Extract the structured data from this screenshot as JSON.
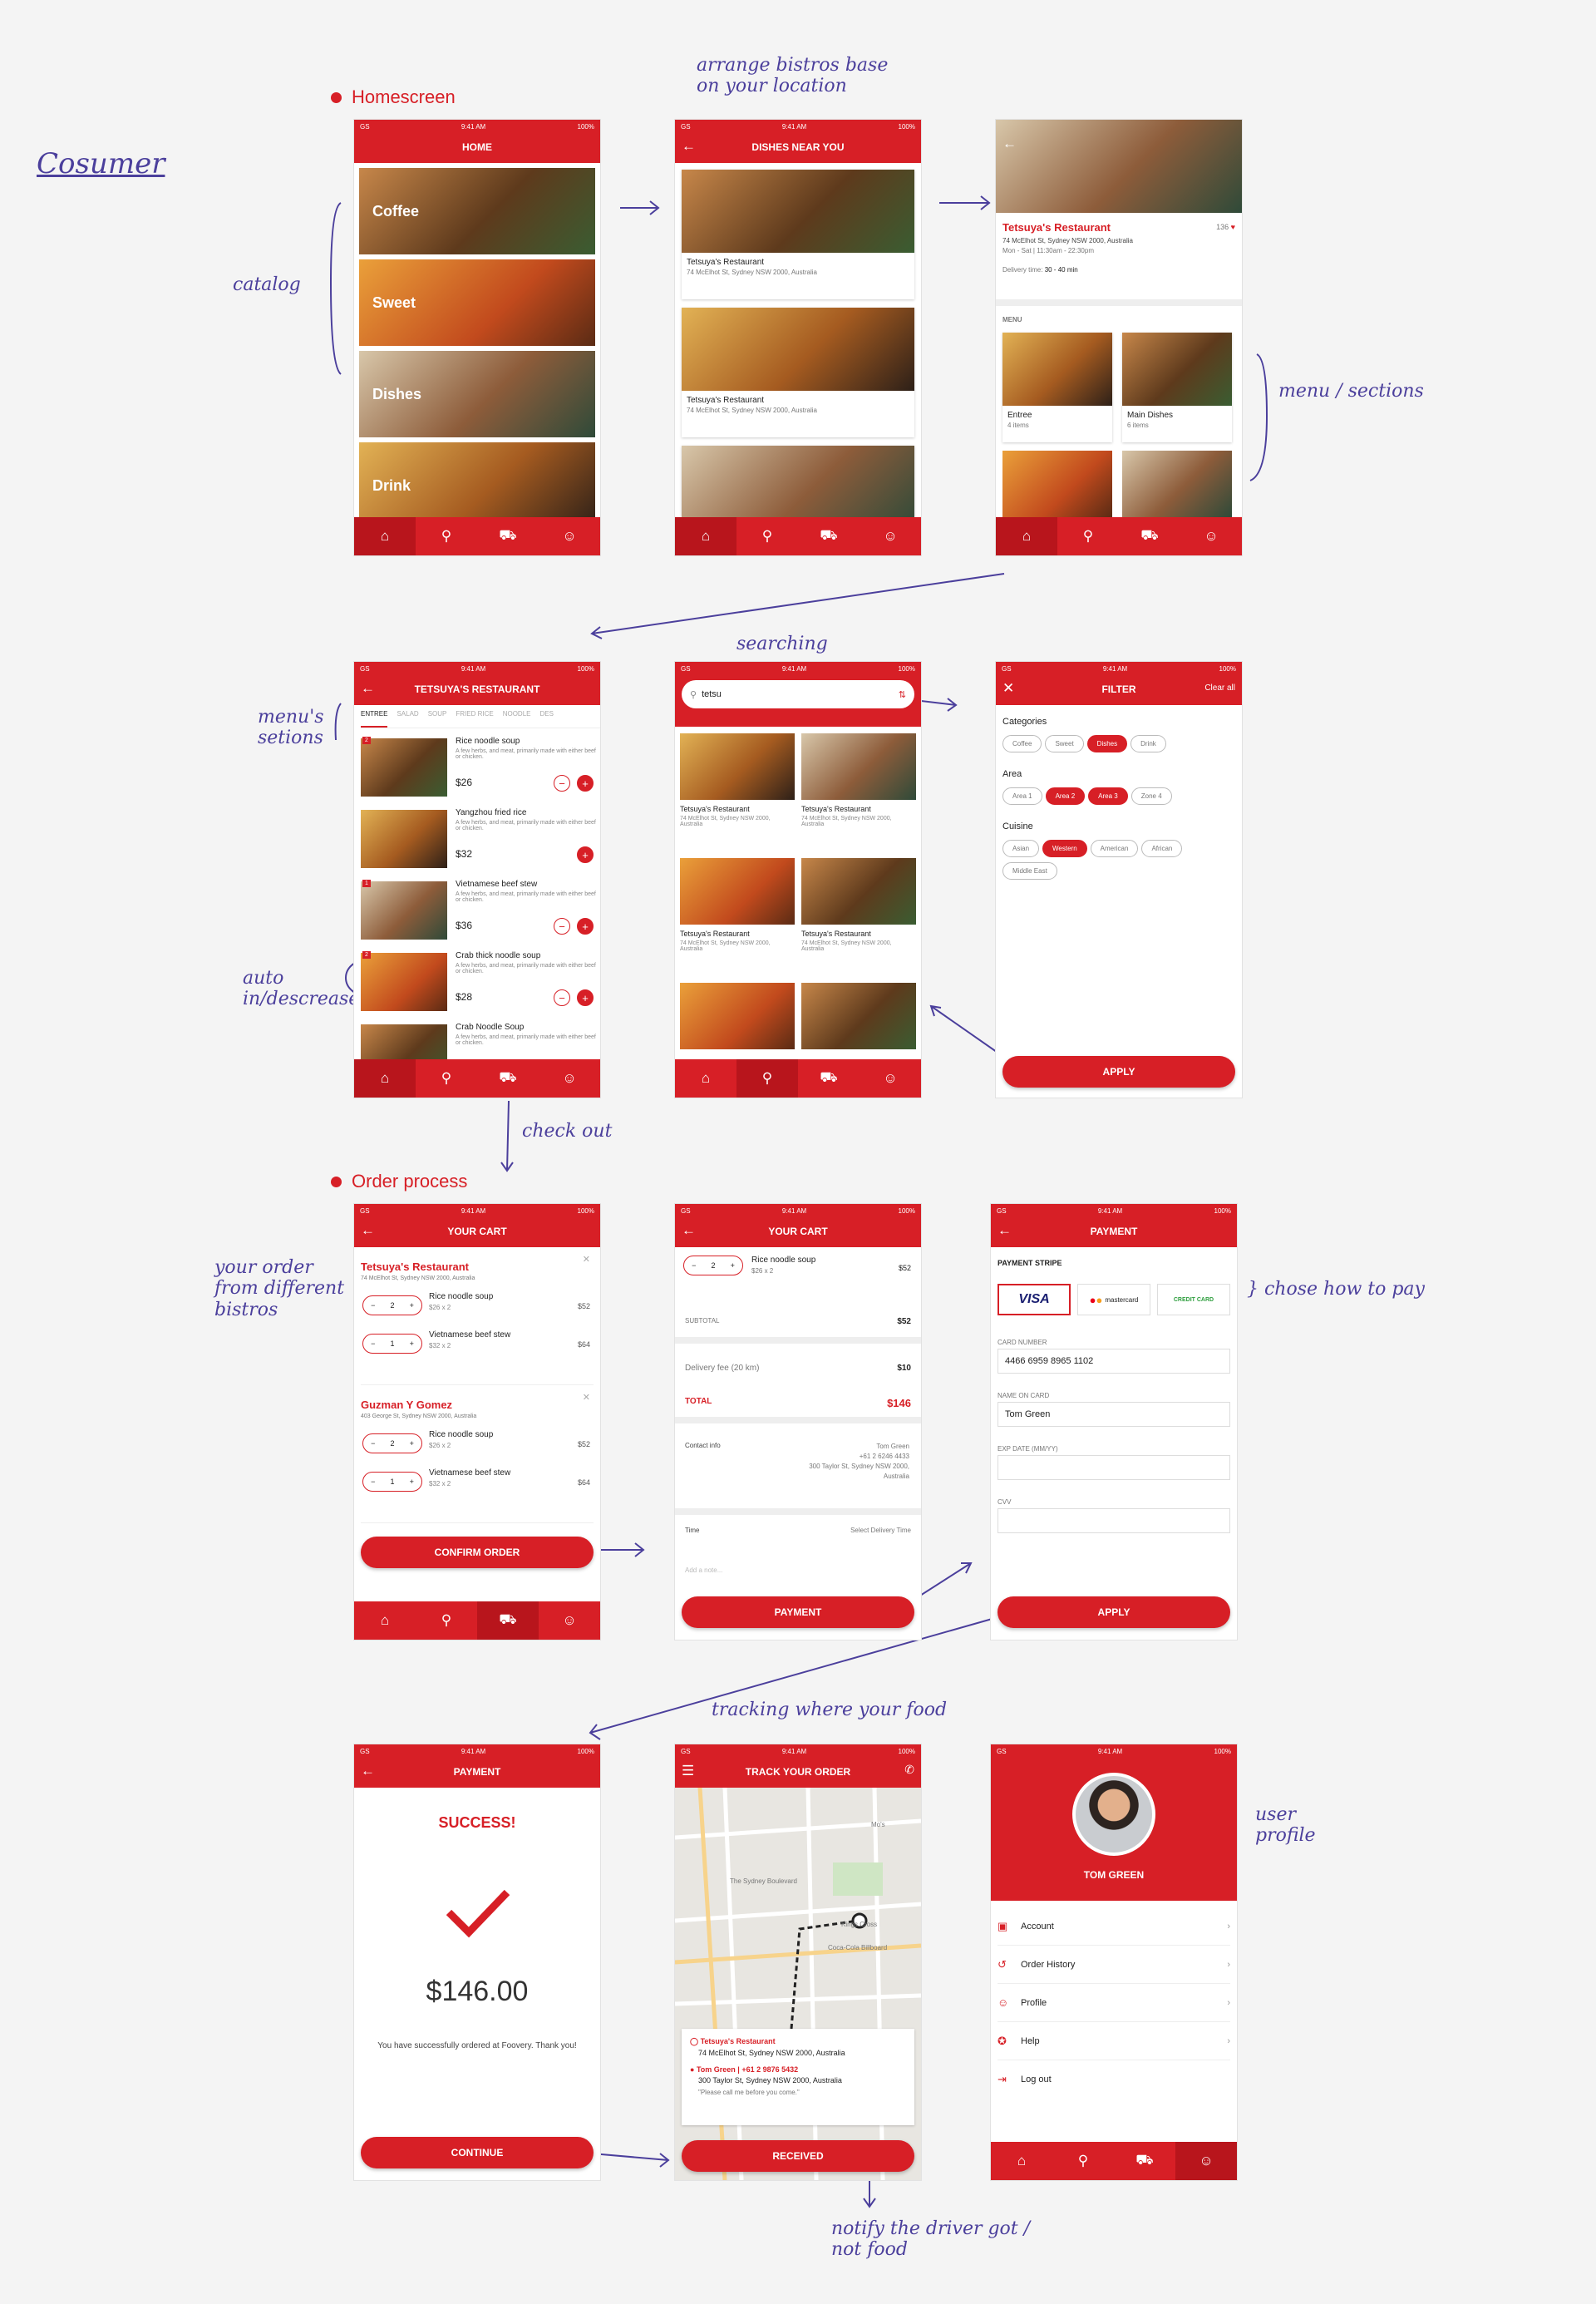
{
  "status": {
    "carrier": "GS",
    "time": "9:41 AM",
    "battery": "100%"
  },
  "annotations": {
    "consumer": "Cosumer",
    "arrange": "arrange bistros base on your location",
    "catalog": "catalog",
    "menu_sections": "menu / sections",
    "menus_sections": "menu's setions",
    "searching": "searching",
    "auto": "auto in/descrease",
    "checkout": "check out",
    "your_order": "your order from different bistros",
    "choose_pay": "} chose how to pay",
    "tracking": "tracking where your food",
    "user_profile": "user profile",
    "notify": "notify the driver got / not food"
  },
  "sections": {
    "homescreen": "Homescreen",
    "order": "Order process"
  },
  "home": {
    "title": "HOME",
    "categories": [
      "Coffee",
      "Sweet",
      "Dishes",
      "Drink"
    ]
  },
  "nearby": {
    "title": "DISHES NEAR YOU",
    "cards": [
      {
        "name": "Tetsuya's Restaurant",
        "addr": "74 McElhot St, Sydney NSW 2000, Australia"
      },
      {
        "name": "Tetsuya's Restaurant",
        "addr": "74 McElhot St, Sydney NSW 2000, Australia"
      }
    ]
  },
  "restaurant": {
    "name": "Tetsuya's Restaurant",
    "likes": "136",
    "addr": "74 McElhot St, Sydney NSW 2000, Australia",
    "hours": "Mon - Sat  |  11:30am - 22:30pm",
    "delivery_label": "Delivery time:",
    "delivery": "30 - 40 min",
    "menu_label": "MENU",
    "sections": [
      {
        "name": "Entree",
        "count": "4 items"
      },
      {
        "name": "Main Dishes",
        "count": "6 items"
      }
    ]
  },
  "menu": {
    "title": "TETSUYA'S RESTAURANT",
    "tabs": [
      "ENTREE",
      "SALAD",
      "SOUP",
      "FRIED RICE",
      "NOODLE",
      "DES"
    ],
    "desc": "A few herbs, and meat, primarily made with either beef or chicken.",
    "items": [
      {
        "badge": "2",
        "name": "Rice noodle soup",
        "price": "$26"
      },
      {
        "badge": "",
        "name": "Yangzhou fried rice",
        "price": "$32"
      },
      {
        "badge": "1",
        "name": "Vietnamese beef stew",
        "price": "$36"
      },
      {
        "badge": "2",
        "name": "Crab thick noodle soup",
        "price": "$28"
      },
      {
        "badge": "",
        "name": "Crab Noodle Soup",
        "price": ""
      }
    ]
  },
  "search": {
    "query": "tetsu",
    "results": [
      {
        "name": "Tetsuya's Restaurant",
        "addr": "74 McElhot St, Sydney NSW 2000, Australia"
      },
      {
        "name": "Tetsuya's Restaurant",
        "addr": "74 McElhot St, Sydney NSW 2000, Australia"
      },
      {
        "name": "Tetsuya's Restaurant",
        "addr": "74 McElhot St, Sydney NSW 2000, Australia"
      },
      {
        "name": "Tetsuya's Restaurant",
        "addr": "74 McElhot St, Sydney NSW 2000, Australia"
      }
    ]
  },
  "filter": {
    "title": "FILTER",
    "clear": "Clear all",
    "categories_label": "Categories",
    "categories": [
      "Coffee",
      "Sweet",
      "Dishes",
      "Drink"
    ],
    "area_label": "Area",
    "areas": [
      "Area 1",
      "Area 2",
      "Area 3",
      "Zone 4"
    ],
    "cuisine_label": "Cuisine",
    "cuisines": [
      "Asian",
      "Western",
      "American",
      "African",
      "Middle East"
    ],
    "apply": "APPLY"
  },
  "cart": {
    "title": "YOUR CART",
    "groups": [
      {
        "name": "Tetsuya's Restaurant",
        "addr": "74 McElhot St, Sydney NSW 2000, Australia",
        "items": [
          {
            "qty": "2",
            "name": "Rice noodle soup",
            "sub": "$26 x 2",
            "total": "$52"
          },
          {
            "qty": "1",
            "name": "Vietnamese beef stew",
            "sub": "$32 x 2",
            "total": "$64"
          }
        ]
      },
      {
        "name": "Guzman Y Gomez",
        "addr": "403 George St, Sydney NSW 2000, Australia",
        "items": [
          {
            "qty": "2",
            "name": "Rice noodle soup",
            "sub": "$26 x 2",
            "total": "$52"
          },
          {
            "qty": "1",
            "name": "Vietnamese beef stew",
            "sub": "$32 x 2",
            "total": "$64"
          }
        ]
      }
    ],
    "confirm": "CONFIRM ORDER"
  },
  "summary": {
    "title": "YOUR CART",
    "item": "Rice noodle soup",
    "item_sub": "$26 x 2",
    "qty": "2",
    "item_total": "$52",
    "subtotal_label": "SUBTOTAL",
    "subtotal": "$52",
    "fee_label": "Delivery fee (20 km)",
    "fee": "$10",
    "total_label": "TOTAL",
    "total": "$146",
    "contact_label": "Contact info",
    "contact_name": "Tom Green",
    "contact_phone": "+61 2 6246 4433",
    "contact_addr": "300 Taylor St, Sydney NSW 2000, Australia",
    "time_label": "Time",
    "time_value": "Select Delivery Time",
    "note": "Add a note...",
    "payment": "PAYMENT"
  },
  "payment": {
    "title": "PAYMENT",
    "stripe": "PAYMENT STRIPE",
    "methods": [
      "VISA",
      "mastercard",
      "CREDIT CARD"
    ],
    "card_label": "CARD NUMBER",
    "card": "4466 6959 8965 1102",
    "name_label": "NAME ON CARD",
    "name": "Tom Green",
    "exp_label": "EXP DATE (MM/YY)",
    "cvv_label": "CVV",
    "apply": "APPLY"
  },
  "success": {
    "title": "PAYMENT",
    "heading": "SUCCESS!",
    "amount": "$146.00",
    "msg": "You have successfully ordered at Foovery. Thank you!",
    "continue": "CONTINUE"
  },
  "track": {
    "title": "TRACK YOUR ORDER",
    "rest": "Tetsuya's Restaurant",
    "rest_addr": "74 McElhot St, Sydney NSW 2000, Australia",
    "user": "Tom Green",
    "phone": "+61 2 9876 5432",
    "user_addr": "300 Taylor St, Sydney NSW 2000, Australia",
    "note": "\"Please call me before you come.\"",
    "received": "RECEIVED",
    "map_labels": [
      "The Sydney Boulevard",
      "Coca-Cola Billboard",
      "Kings Cross",
      "Mo's"
    ]
  },
  "profile": {
    "name": "TOM GREEN",
    "items": [
      "Account",
      "Order History",
      "Profile",
      "Help",
      "Log out"
    ]
  },
  "colors": {
    "brand": "#d71f26",
    "annotation": "#4b3f9c"
  }
}
